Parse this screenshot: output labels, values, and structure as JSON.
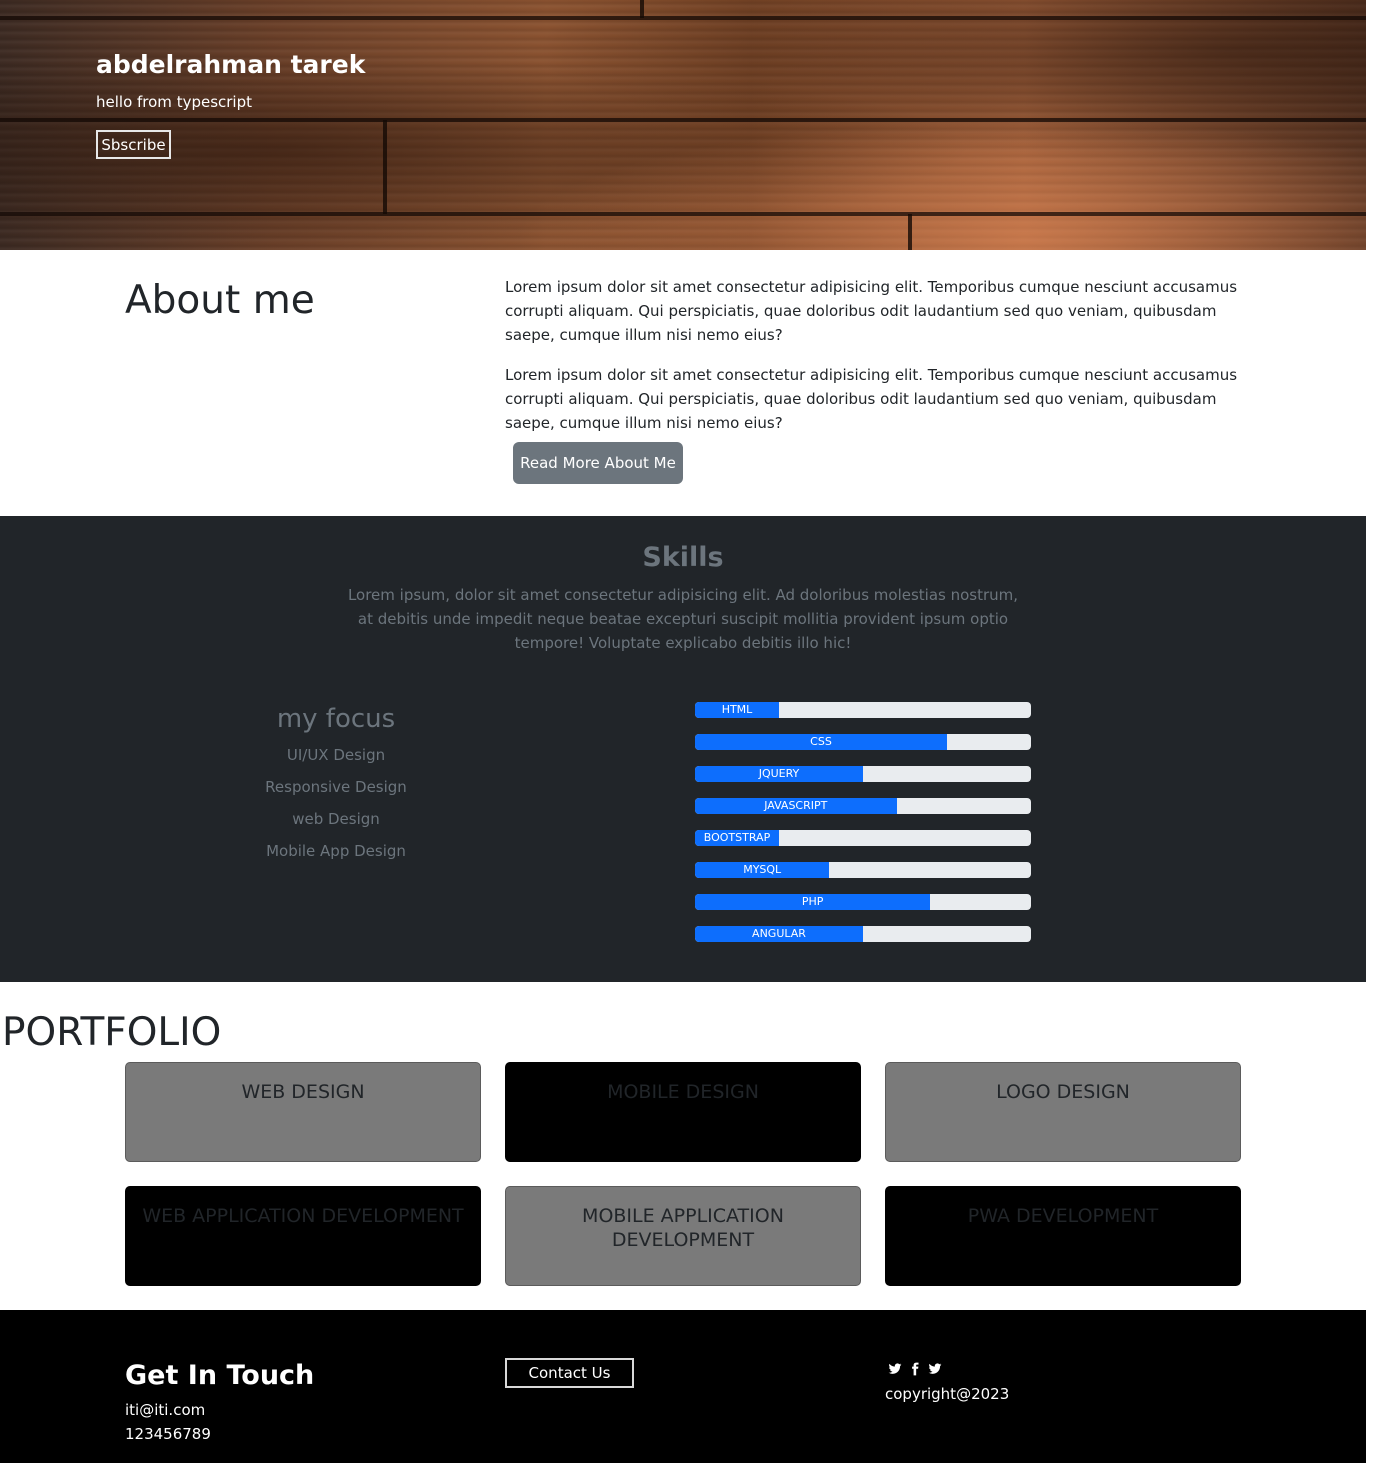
{
  "hero": {
    "title": "abdelrahman tarek",
    "subtitle": "hello from typescript",
    "button": "Sbscribe"
  },
  "about": {
    "title": "About me",
    "paragraphs": [
      "Lorem ipsum dolor sit amet consectetur adipisicing elit. Temporibus cumque nesciunt accusamus corrupti aliquam. Qui perspiciatis, quae doloribus odit laudantium sed quo veniam, quibusdam saepe, cumque illum nisi nemo eius?",
      "Lorem ipsum dolor sit amet consectetur adipisicing elit. Temporibus cumque nesciunt accusamus corrupti aliquam. Qui perspiciatis, quae doloribus odit laudantium sed quo veniam, quibusdam saepe, cumque illum nisi nemo eius?"
    ],
    "button": "Read More About Me"
  },
  "skills": {
    "title": "Skills",
    "description": "Lorem ipsum, dolor sit amet consectetur adipisicing elit. Ad doloribus molestias nostrum, at debitis unde impedit neque beatae excepturi suscipit mollitia provident ipsum optio tempore! Voluptate explicabo debitis illo hic!",
    "focus_title": "my focus",
    "focus_items": [
      "UI/UX Design",
      "Responsive Design",
      "web Design",
      "Mobile App Design"
    ],
    "bars": [
      {
        "label": "HTML",
        "percent": 25
      },
      {
        "label": "CSS",
        "percent": 75
      },
      {
        "label": "JQUERY",
        "percent": 50
      },
      {
        "label": "JAVASCRIPT",
        "percent": 60
      },
      {
        "label": "BOOTSTRAP",
        "percent": 25
      },
      {
        "label": "MYSQL",
        "percent": 40
      },
      {
        "label": "PHP",
        "percent": 70
      },
      {
        "label": "ANGULAR",
        "percent": 50
      }
    ],
    "bar_color": "#0d6efd",
    "track_color": "#e9ecef"
  },
  "portfolio": {
    "title": "PORTFOLIO",
    "cards": [
      "WEB DESIGN",
      "MOBILE DESIGN",
      "LOGO DESIGN",
      "WEB APPLICATION DEVELOPMENT",
      "MOBILE APPLICATION DEVELOPMENT",
      "PWA DEVELOPMENT"
    ]
  },
  "footer": {
    "title": "Get In Touch",
    "email": "iti@iti.com",
    "phone": "123456789",
    "contact_button": "Contact Us",
    "social_icons": [
      "twitter-icon",
      "facebook-icon",
      "twitter-icon"
    ],
    "copyright": "copyright@2023"
  }
}
